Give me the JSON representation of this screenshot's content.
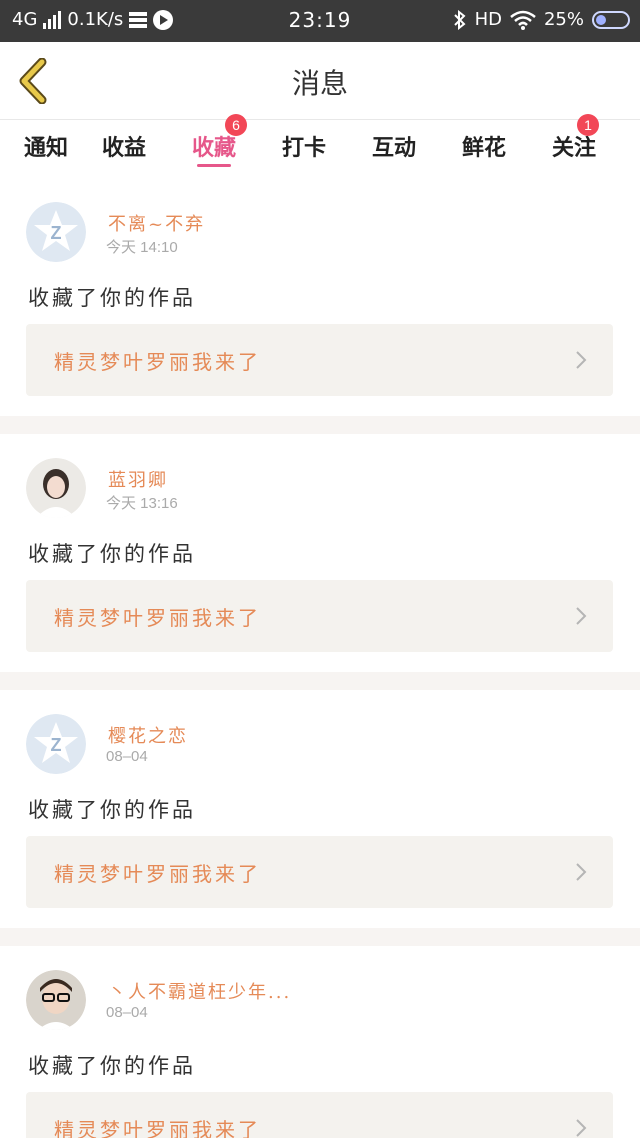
{
  "status_bar": {
    "network": "4G",
    "speed": "0.1K/s",
    "time": "23:19",
    "hd": "HD",
    "battery": "25%"
  },
  "header": {
    "title": "消息"
  },
  "tabs": [
    {
      "label": "通知"
    },
    {
      "label": "收益"
    },
    {
      "label": "收藏",
      "badge": "6",
      "active": true
    },
    {
      "label": "打卡"
    },
    {
      "label": "互动"
    },
    {
      "label": "鲜花"
    },
    {
      "label": "关注",
      "badge": "1"
    }
  ],
  "messages": [
    {
      "username": "不离~不弃",
      "time": "今天 14:10",
      "action": "收藏了你的作品",
      "work_title": "精灵梦叶罗丽我来了",
      "avatar": "default-z-icon"
    },
    {
      "username": "蓝羽卿",
      "time": "今天 13:16",
      "action": "收藏了你的作品",
      "work_title": "精灵梦叶罗丽我来了",
      "avatar": "photo-girl"
    },
    {
      "username": "樱花之恋",
      "time": "08–04",
      "action": "收藏了你的作品",
      "work_title": "精灵梦叶罗丽我来了",
      "avatar": "default-z-icon"
    },
    {
      "username": "丶人不霸道枉少年...",
      "time": "08–04",
      "action": "收藏了你的作品",
      "work_title": "精灵梦叶罗丽我来了",
      "avatar": "photo-boy"
    }
  ],
  "colors": {
    "accent": "#e6578a",
    "orange": "#e58a57",
    "badge": "#f24757",
    "card": "#f4f2ee"
  }
}
